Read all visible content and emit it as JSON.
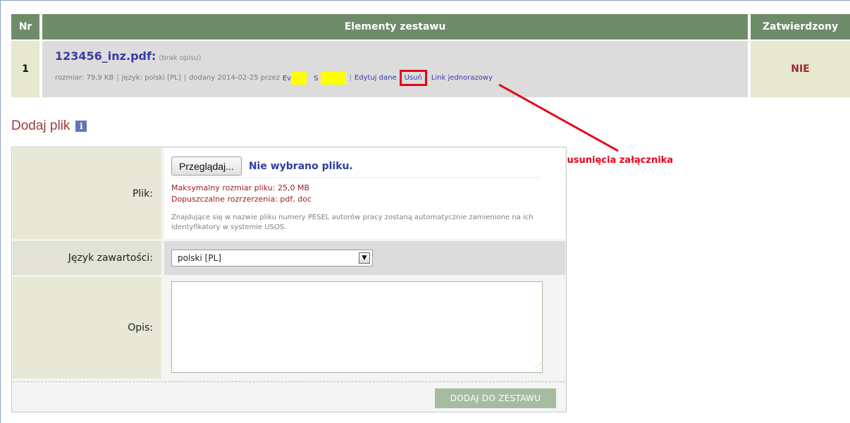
{
  "table": {
    "headers": {
      "nr": "Nr",
      "elements": "Elementy zestawu",
      "approved": "Zatwierdzony"
    },
    "rows": [
      {
        "nr": "1",
        "file_name": "123456_inz.pdf:",
        "description": "(brak opisu)",
        "meta_size": "rozmiar: 79,9 KB",
        "meta_language": "język: polski [PL]",
        "meta_added": "dodany 2014-02-25 przez",
        "author_first_fragment": "Ev",
        "author_last_fragment": "S",
        "edit_link": "Edytuj dane",
        "delete_link": "Usuń",
        "one_time_link": "Link jednorazowy",
        "approved": "NIE"
      }
    ]
  },
  "annotation": {
    "text": "Przyciskj usunięcia załącznika",
    "color": "#e8001a"
  },
  "section": {
    "title": "Dodaj plik",
    "info_icon": "i"
  },
  "form": {
    "file_label": "Plik:",
    "browse_button": "Przeglądaj...",
    "no_file_text": "Nie wybrano pliku.",
    "max_size": "Maksymalny rozmiar pliku: 25,0 MB",
    "allowed_ext": "Dopuszczalne rozrzerzenia: pdf, doc",
    "pesel_hint": "Znajdujące się w nazwie pliku numery PESEL autorów pracy zostaną automatycznie zamienione na ich identyfikatory w systemie USOS.",
    "language_label": "Język zawartości:",
    "language_selected": "polski [PL]",
    "description_label": "Opis:",
    "description_value": "",
    "submit_button": "DODAJ DO ZESTAWU"
  },
  "colors": {
    "header_green": "#6e8c69",
    "link_blue": "#3a3aa8",
    "approved_red": "#9b2a2a",
    "highlight_yellow": "#ffff00",
    "submit_green": "#a5bca0"
  }
}
